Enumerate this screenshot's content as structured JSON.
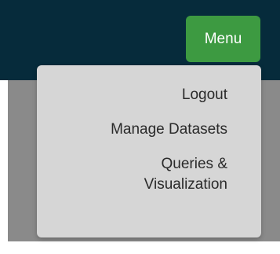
{
  "header": {
    "menu_label": "Menu"
  },
  "menu": {
    "items": [
      {
        "label": "Logout"
      },
      {
        "label": "Manage Datasets"
      },
      {
        "label": "Queries &",
        "label_line2": "Visualization"
      }
    ]
  },
  "colors": {
    "header_bg": "#062b3b",
    "menu_button": "#3d9a41",
    "dropdown_bg": "#d6d6d6",
    "backdrop": "#8a8a8a"
  }
}
